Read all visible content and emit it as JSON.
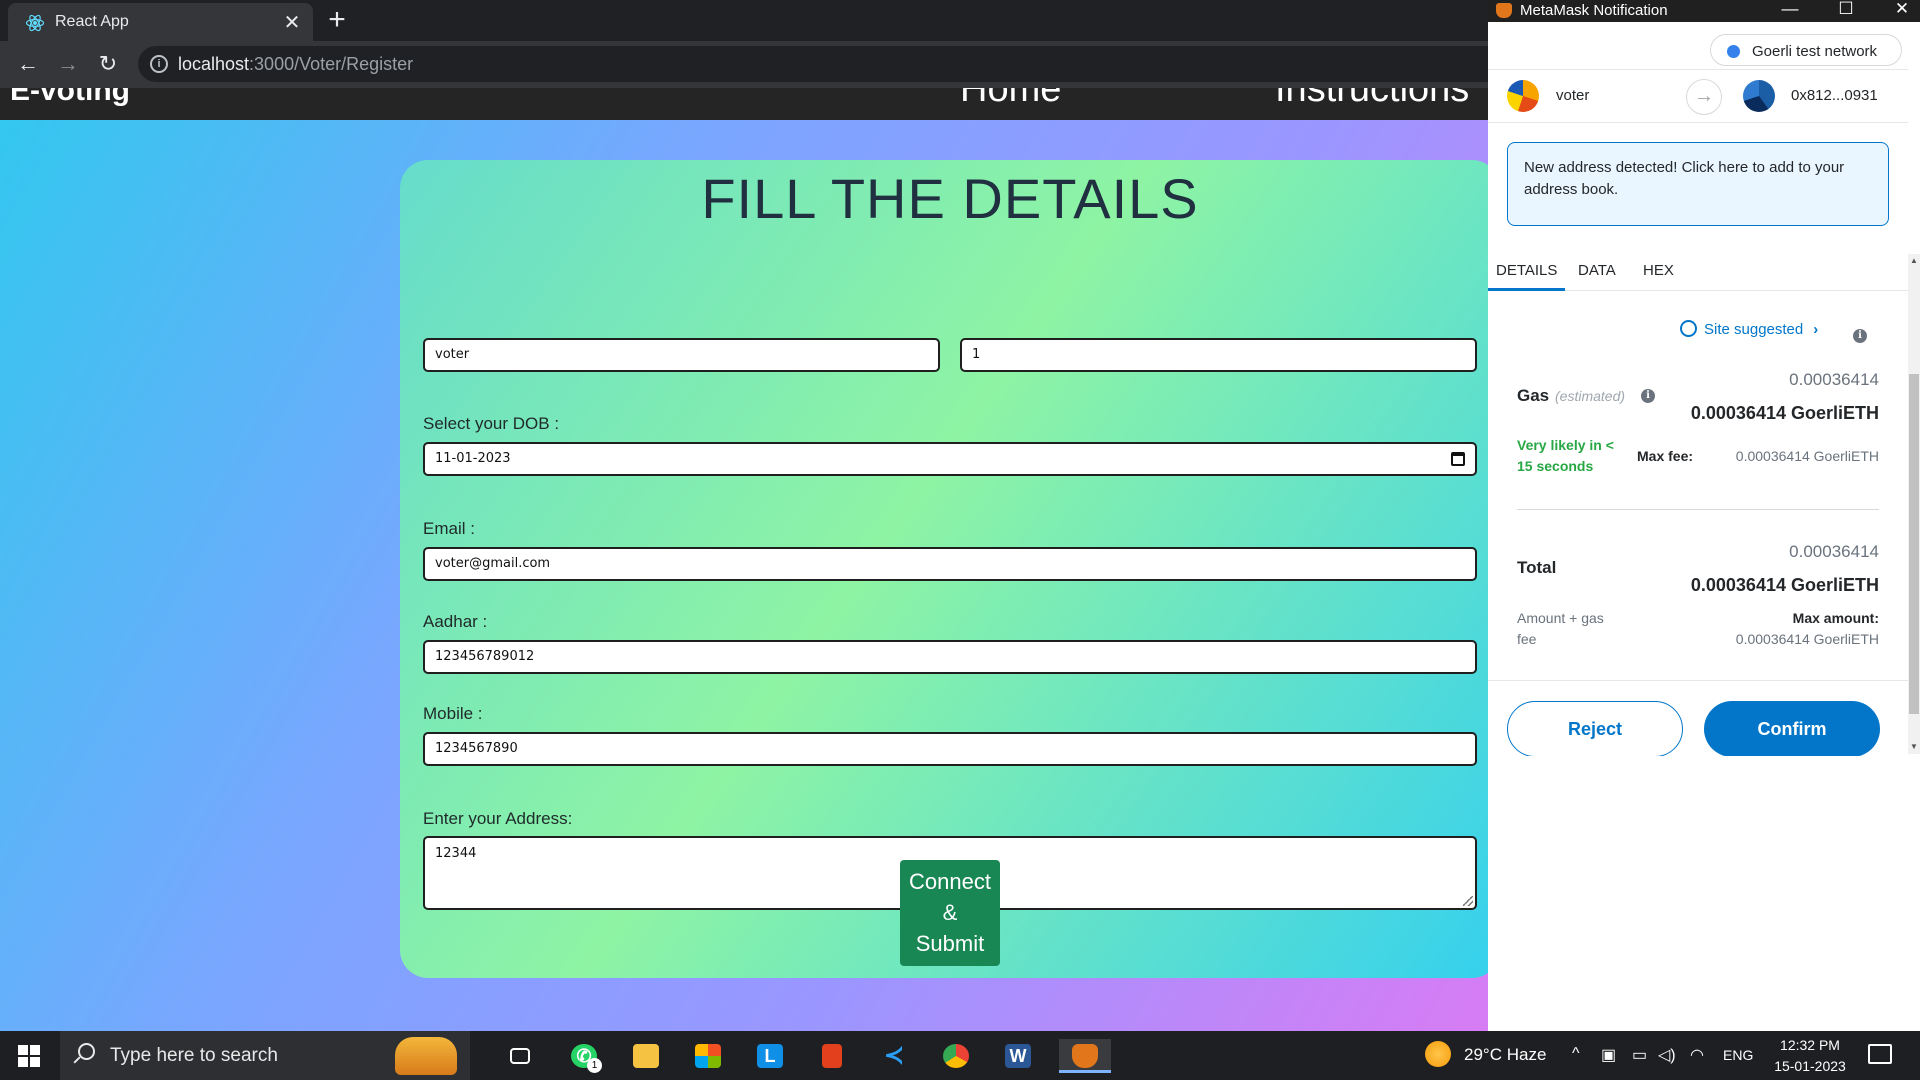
{
  "browser": {
    "tab_title": "React App",
    "close_glyph": "✕",
    "newtab_glyph": "+",
    "url_host": "localhost",
    "url_path": ":3000/Voter/Register",
    "back_glyph": "←",
    "forward_glyph": "→",
    "reload_glyph": "↻",
    "info_glyph": "i"
  },
  "navbar": {
    "brand": "E-voting",
    "links": [
      "Home",
      "Instructions"
    ]
  },
  "form": {
    "title": "FILL THE DETAILS",
    "name_value": "voter",
    "second_value": "1",
    "dob_label": "Select your DOB :",
    "dob_value": "11-01-2023",
    "email_label": "Email :",
    "email_value": "voter@gmail.com",
    "aadhar_label": "Aadhar :",
    "aadhar_value": "123456789012",
    "mobile_label": "Mobile :",
    "mobile_value": "1234567890",
    "address_label": "Enter your Address:",
    "address_value": "12344",
    "submit_lines": [
      "Connect",
      "&",
      "Submit"
    ]
  },
  "metamask": {
    "window_title": "MetaMask Notification",
    "window_buttons": [
      "—",
      "☐",
      "✕"
    ],
    "network": "Goerli test network",
    "from_account": "voter",
    "to_account": "0x812...0931",
    "arrow_glyph": "→",
    "alert": "New address detected! Click here to add to your address book.",
    "tabs": [
      "DETAILS",
      "DATA",
      "HEX"
    ],
    "site_suggested": "Site suggested",
    "chevron_glyph": "›",
    "info_glyph": "i",
    "gas_label": "Gas",
    "gas_estimated": "(estimated)",
    "gas_small": "0.00036414",
    "gas_bold": "0.00036414 GoerliETH",
    "likely_line1": "Very likely in <",
    "likely_line2": "15 seconds",
    "max_fee_label": "Max fee:",
    "max_fee_value": "0.00036414 GoerliETH",
    "total_label": "Total",
    "total_small": "0.00036414",
    "total_bold": "0.00036414 GoerliETH",
    "amount_gas_line1": "Amount + gas",
    "amount_gas_line2": "fee",
    "max_amount_label": "Max amount:",
    "max_amount_value": "0.00036414 GoerliETH",
    "reject_label": "Reject",
    "confirm_label": "Confirm"
  },
  "taskbar": {
    "search_placeholder": "Type here to search",
    "apps": [
      "task-view",
      "whatsapp",
      "file-explorer",
      "microsoft-store",
      "lens",
      "office",
      "vscode",
      "chrome",
      "word",
      "metamask"
    ],
    "whatsapp_badge": "1",
    "weather": "29°C  Haze",
    "language": "ENG",
    "time": "12:32 PM",
    "date": "15-01-2023",
    "tray_glyphs": [
      "^",
      "▣",
      "▭",
      "◁)",
      "◠"
    ]
  },
  "colors": {
    "confirm_blue": "#0376c9",
    "submit_green": "#198754",
    "likely_green": "#28a745",
    "navbar_dark": "#252525"
  },
  "icons": {
    "favicon": "react-icon",
    "calendar": "calendar-icon",
    "site_suggested": "globe-icon",
    "info": "info-icon"
  }
}
